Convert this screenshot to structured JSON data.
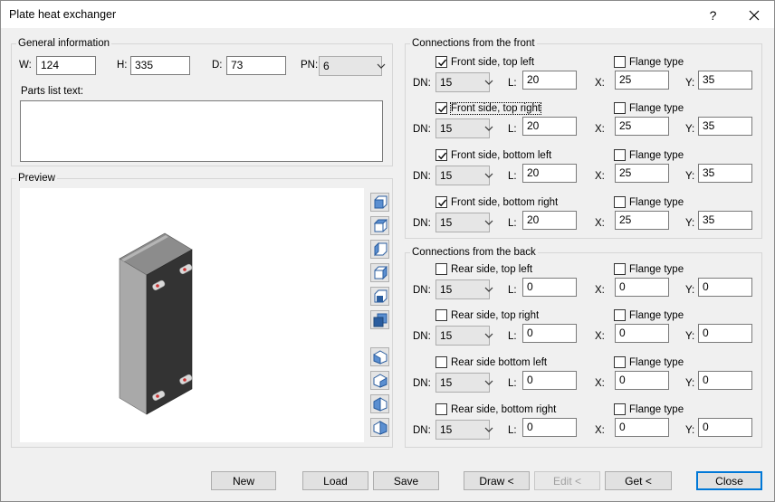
{
  "window": {
    "title": "Plate heat exchanger",
    "help": "?",
    "close": "✕"
  },
  "general": {
    "label": "General information",
    "w_label": "W:",
    "w": "124",
    "h_label": "H:",
    "h": "335",
    "d_label": "D:",
    "d": "73",
    "pn_label": "PN:",
    "pn": "6",
    "parts_label": "Parts list text:",
    "parts_text": ""
  },
  "preview": {
    "label": "Preview"
  },
  "front": {
    "label": "Connections from the front",
    "rows": [
      {
        "name": "Front side, top left",
        "checked": true,
        "dn": "15",
        "l": "20",
        "x": "25",
        "y": "35",
        "flange": "Flange type"
      },
      {
        "name": "Front side, top right",
        "checked": true,
        "dn": "15",
        "l": "20",
        "x": "25",
        "y": "35",
        "flange": "Flange type"
      },
      {
        "name": "Front side, bottom left",
        "checked": true,
        "dn": "15",
        "l": "20",
        "x": "25",
        "y": "35",
        "flange": "Flange type"
      },
      {
        "name": "Front side, bottom right",
        "checked": true,
        "dn": "15",
        "l": "20",
        "x": "25",
        "y": "35",
        "flange": "Flange type"
      }
    ]
  },
  "back": {
    "label": "Connections from the back",
    "rows": [
      {
        "name": "Rear side, top left",
        "checked": false,
        "dn": "15",
        "l": "0",
        "x": "0",
        "y": "0",
        "flange": "Flange type"
      },
      {
        "name": "Rear side, top right",
        "checked": false,
        "dn": "15",
        "l": "0",
        "x": "0",
        "y": "0",
        "flange": "Flange type"
      },
      {
        "name": "Rear side bottom left",
        "checked": false,
        "dn": "15",
        "l": "0",
        "x": "0",
        "y": "0",
        "flange": "Flange type"
      },
      {
        "name": "Rear side, bottom right",
        "checked": false,
        "dn": "15",
        "l": "0",
        "x": "0",
        "y": "0",
        "flange": "Flange type"
      }
    ]
  },
  "field_labels": {
    "dn": "DN:",
    "l": "L:",
    "x": "X:",
    "y": "Y:"
  },
  "buttons": {
    "new": "New",
    "load": "Load",
    "save": "Save",
    "draw": "Draw <",
    "edit": "Edit <",
    "get": "Get <",
    "close": "Close"
  },
  "view_icons": [
    "view-front-icon",
    "view-back-icon",
    "view-left-icon",
    "view-right-icon",
    "view-top-icon",
    "view-bottom-icon",
    "iso-view-1-icon",
    "iso-view-2-icon",
    "iso-view-3-icon",
    "iso-view-4-icon"
  ]
}
